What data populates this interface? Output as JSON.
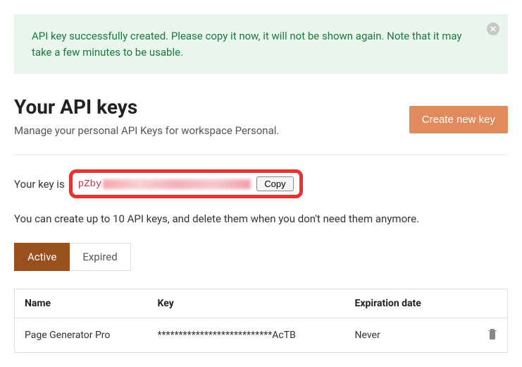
{
  "alert": {
    "message": "API key successfully created. Please copy it now, it will not be shown again. Note that it may take a few minutes to be usable."
  },
  "header": {
    "title": "Your API keys",
    "subtitle": "Manage your personal API Keys for workspace Personal.",
    "create_button": "Create new key"
  },
  "key_display": {
    "prefix_label": "Your key is",
    "visible_prefix": "pZby",
    "copy_button": "Copy"
  },
  "info": {
    "limit_text": "You can create up to 10 API keys, and delete them when you don't need them anymore."
  },
  "tabs": {
    "active": "Active",
    "expired": "Expired"
  },
  "table": {
    "headers": {
      "name": "Name",
      "key": "Key",
      "expiration": "Expiration date"
    },
    "rows": [
      {
        "name": "Page Generator Pro",
        "key": "***************************AcTB",
        "expiration": "Never"
      }
    ]
  }
}
